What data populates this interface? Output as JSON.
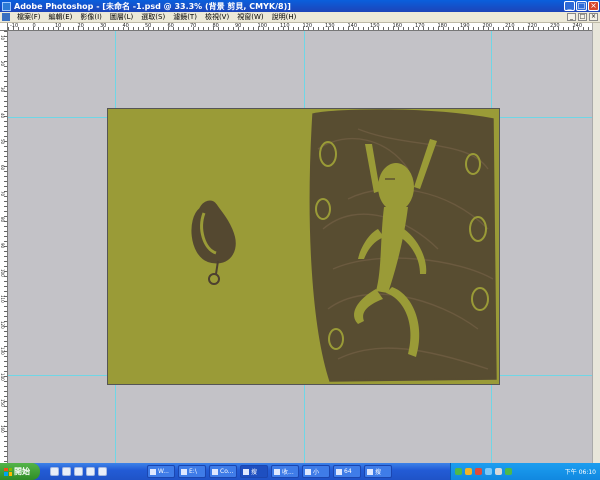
{
  "window": {
    "title": "Adobe Photoshop - [未命名 -1.psd @ 33.3% (背景 剪貝, CMYK/8)]",
    "controls": [
      "_",
      "□",
      "×"
    ]
  },
  "menubar": {
    "items": [
      "檔案(F)",
      "編輯(E)",
      "影像(I)",
      "圖層(L)",
      "選取(S)",
      "濾鏡(T)",
      "檢視(V)",
      "視窗(W)",
      "說明(H)"
    ],
    "doc_controls": [
      "_",
      "□",
      "×"
    ]
  },
  "ruler_top": {
    "ticks": [
      "-10",
      "0",
      "10",
      "20",
      "30",
      "40",
      "50",
      "60",
      "70",
      "80",
      "90",
      "100",
      "110",
      "120",
      "130",
      "140",
      "150",
      "160",
      "170",
      "180",
      "190",
      "200",
      "210",
      "220",
      "230",
      "240"
    ]
  },
  "ruler_left": {
    "ticks": [
      "10",
      "20",
      "30",
      "40",
      "50",
      "60",
      "70",
      "80",
      "90",
      "100",
      "110",
      "120",
      "130",
      "140",
      "150",
      "160"
    ]
  },
  "document": {
    "background_color": "#9a9b37",
    "ink_color": "#4d4030",
    "guide_color": "#6fd6e6"
  },
  "taskbar": {
    "start_label": "開始",
    "tasks": [
      "W...",
      "E:\\",
      "Co...",
      "搜",
      "收...",
      "小",
      "64",
      "搜"
    ],
    "clock": "下午 06:10"
  }
}
